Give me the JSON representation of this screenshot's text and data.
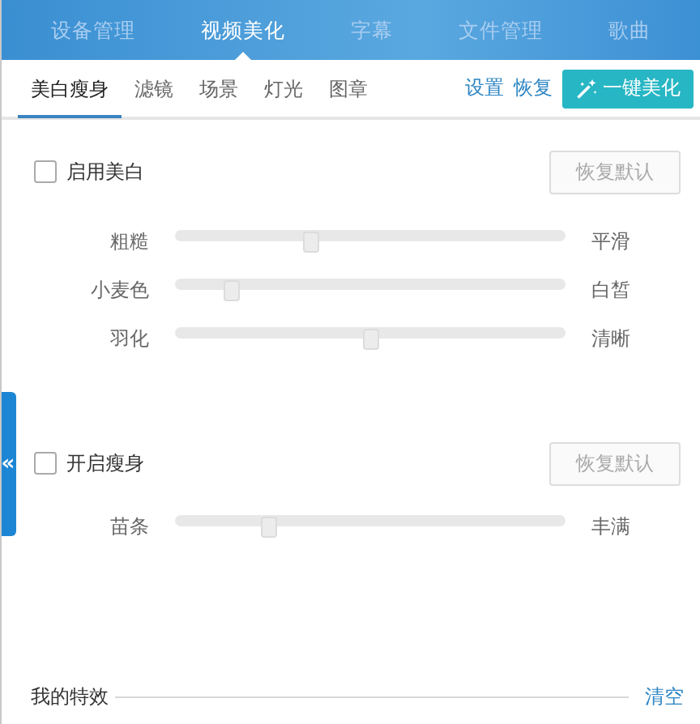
{
  "top_tabs": [
    {
      "label": "设备管理",
      "selected": false
    },
    {
      "label": "视频美化",
      "selected": true
    },
    {
      "label": "字幕",
      "selected": false
    },
    {
      "label": "文件管理",
      "selected": false
    },
    {
      "label": "歌曲",
      "selected": false
    }
  ],
  "sub_tabs": [
    {
      "label": "美白瘦身",
      "selected": true
    },
    {
      "label": "滤镜",
      "selected": false
    },
    {
      "label": "场景",
      "selected": false
    },
    {
      "label": "灯光",
      "selected": false
    },
    {
      "label": "图章",
      "selected": false
    }
  ],
  "toolbar": {
    "settings_link": "设置",
    "restore_link": "恢复",
    "beautify_button": "一键美化"
  },
  "side_handle": "«",
  "sections": [
    {
      "checkbox": {
        "label": "启用美白",
        "checked": false
      },
      "reset_button": {
        "label": "恢复默认",
        "disabled": true
      },
      "sliders": [
        {
          "left": "粗糙",
          "right": "平滑",
          "level": 0.34
        },
        {
          "left": "小麦色",
          "right": "白皙",
          "level": 0.13
        },
        {
          "left": "羽化",
          "right": "清晰",
          "level": 0.5
        }
      ]
    },
    {
      "checkbox": {
        "label": "开启瘦身",
        "checked": false
      },
      "reset_button": {
        "label": "恢复默认",
        "disabled": true
      },
      "sliders": [
        {
          "left": "苗条",
          "right": "丰满",
          "level": 0.23
        }
      ]
    }
  ],
  "footer": {
    "title": "我的特效",
    "clear_link": "清空"
  }
}
